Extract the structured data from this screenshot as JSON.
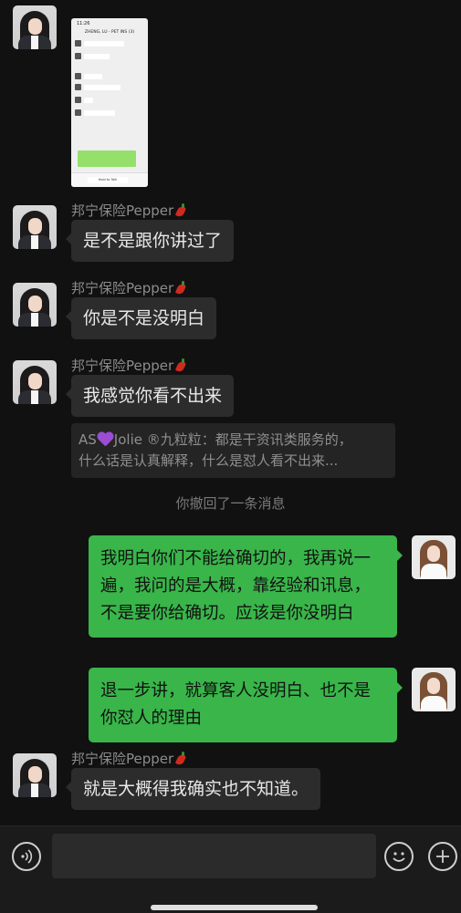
{
  "messages": [
    {
      "sender": "邦宁保险Pepper",
      "text": "是不是跟你讲过了"
    },
    {
      "sender": "邦宁保险Pepper",
      "text": "你是不是没明白"
    },
    {
      "sender": "邦宁保险Pepper",
      "text": "我感觉你看不出来"
    }
  ],
  "quote": {
    "prefix": "AS",
    "name_rest": "Jolie ®九粒粒：都是干资讯类服务的，",
    "line2": "什么话是认真解释，什么是怼人看不出来..."
  },
  "system": {
    "recalled": "你撤回了一条消息"
  },
  "my_messages": [
    {
      "text": "我明白你们不能给确切的，我再说一遍，我问的是大概，靠经验和讯息，不是要你给确切。应该是你没明白"
    },
    {
      "text": "退一步讲，就算客人没明白、也不是你怼人的理由"
    }
  ],
  "last_message": {
    "sender": "邦宁保险Pepper",
    "text": "就是大概得我确实也不知道。"
  },
  "thumbnail": {
    "status_time": "11:26",
    "title": "ZHENG, LU - PET INS (3)",
    "hold_to_talk": "Hold to Talk"
  },
  "colors": {
    "background": "#111111",
    "incoming_bubble": "#2c2c2c",
    "outgoing_bubble": "#39b54a",
    "secondary_text": "#8c8c8c"
  },
  "icons": {
    "voice": "voice-icon",
    "emoji": "emoji-icon",
    "plus": "plus-icon"
  }
}
